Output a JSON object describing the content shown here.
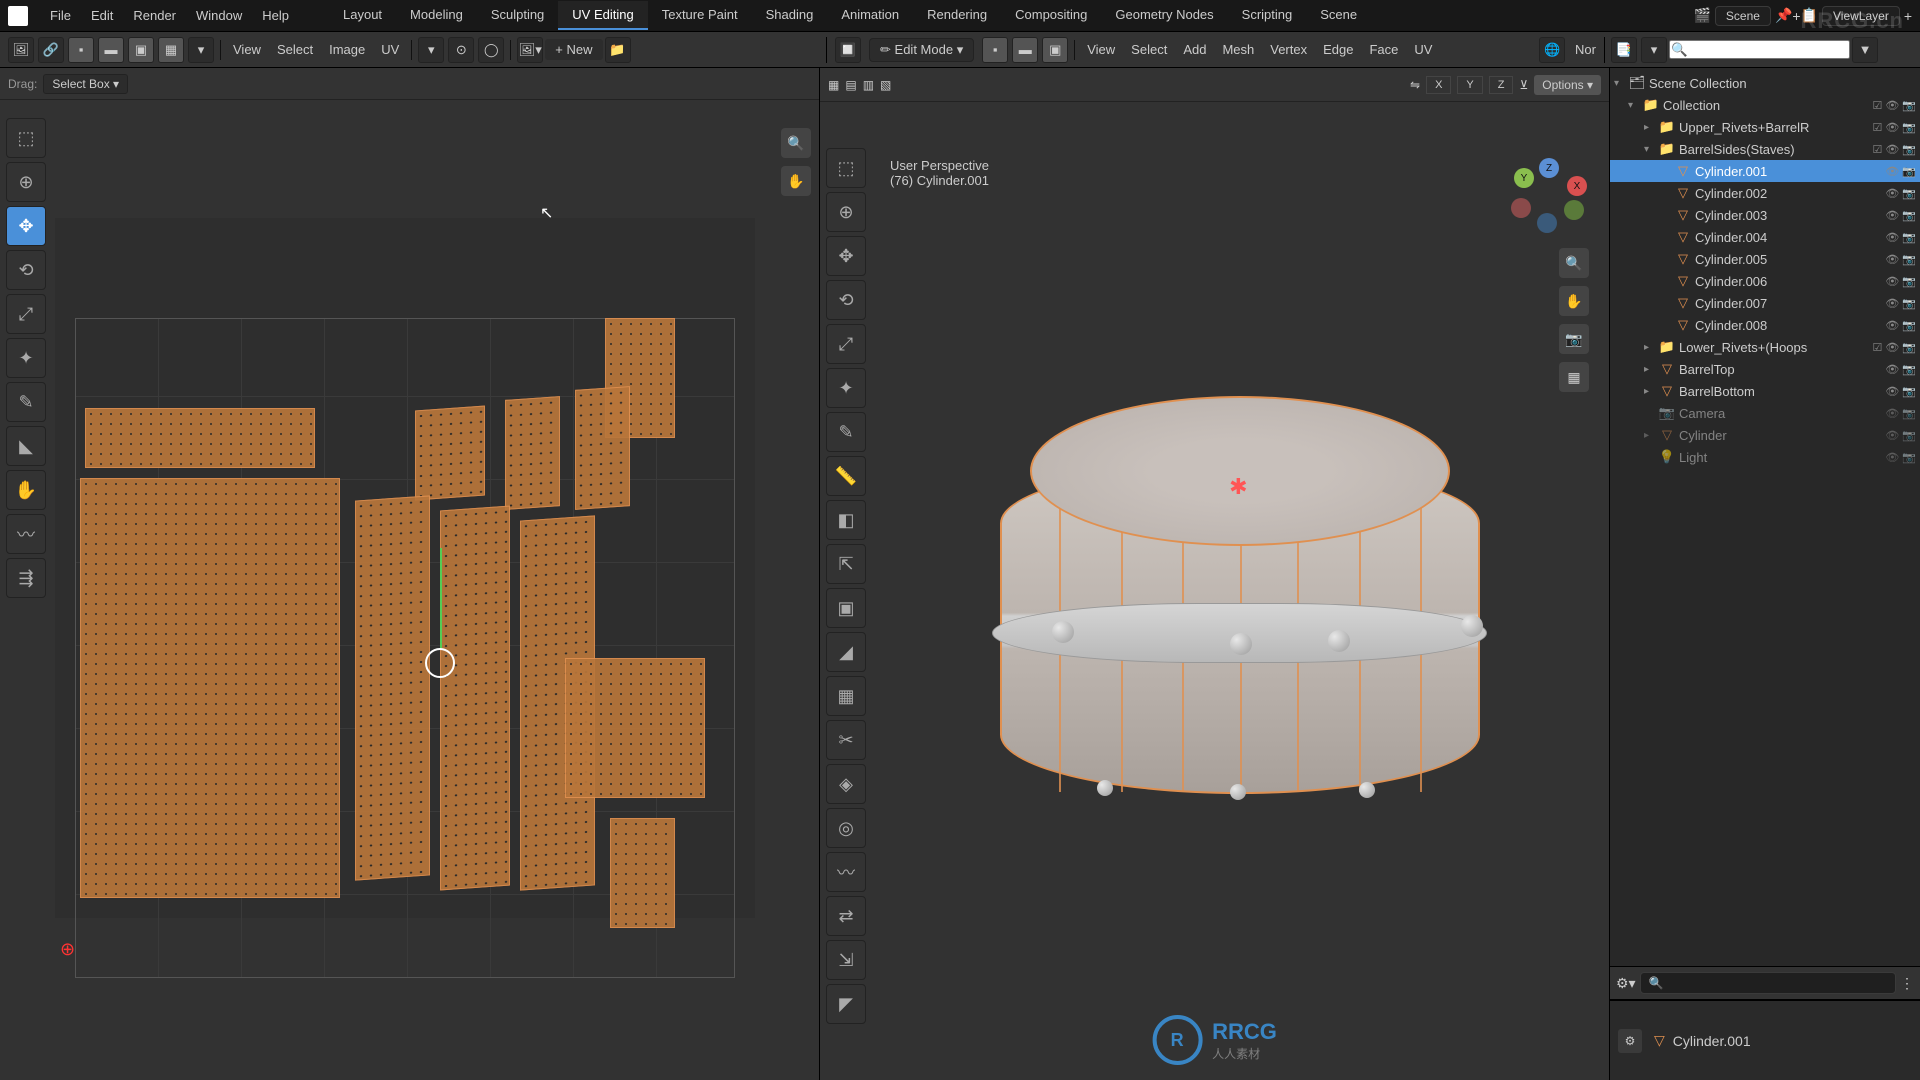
{
  "top_menu": {
    "file": "File",
    "edit": "Edit",
    "render": "Render",
    "window": "Window",
    "help": "Help"
  },
  "workspaces": {
    "layout": "Layout",
    "modeling": "Modeling",
    "sculpting": "Sculpting",
    "uv": "UV Editing",
    "texpaint": "Texture Paint",
    "shading": "Shading",
    "animation": "Animation",
    "rendering": "Rendering",
    "compositing": "Compositing",
    "geonodes": "Geometry Nodes",
    "scripting": "Scripting",
    "scene_label": "Scene"
  },
  "scene_name": "Scene",
  "viewlayer_name": "ViewLayer",
  "watermark": "RRCG.cn",
  "uv_header": {
    "view": "View",
    "select": "Select",
    "image": "Image",
    "uv": "UV",
    "new": "+ New",
    "open_icon": "📁"
  },
  "uv_drag": {
    "label": "Drag:",
    "mode": "Select Box"
  },
  "vp_header": {
    "mode": "Edit Mode",
    "view": "View",
    "select": "Select",
    "add": "Add",
    "mesh": "Mesh",
    "vertex": "Vertex",
    "edge": "Edge",
    "face": "Face",
    "uv": "UV",
    "normals": "Nor"
  },
  "vp_options": "Options",
  "vp_axes": {
    "x": "X",
    "y": "Y",
    "z": "Z"
  },
  "vp_overlay": {
    "persp": "User Perspective",
    "object": "(76) Cylinder.001"
  },
  "outliner": {
    "scene_collection": "Scene Collection",
    "collection": "Collection",
    "items": [
      {
        "name": "Upper_Rivets+BarrelR",
        "indent": 2,
        "expanded": false,
        "coll": true
      },
      {
        "name": "BarrelSides(Staves)",
        "indent": 2,
        "expanded": true,
        "coll": true
      },
      {
        "name": "Cylinder.001",
        "indent": 3,
        "expanded": false,
        "selected": true
      },
      {
        "name": "Cylinder.002",
        "indent": 3,
        "expanded": false
      },
      {
        "name": "Cylinder.003",
        "indent": 3,
        "expanded": false
      },
      {
        "name": "Cylinder.004",
        "indent": 3,
        "expanded": false
      },
      {
        "name": "Cylinder.005",
        "indent": 3,
        "expanded": false
      },
      {
        "name": "Cylinder.006",
        "indent": 3,
        "expanded": false
      },
      {
        "name": "Cylinder.007",
        "indent": 3,
        "expanded": false
      },
      {
        "name": "Cylinder.008",
        "indent": 3,
        "expanded": false
      },
      {
        "name": "Lower_Rivets+(Hoops",
        "indent": 2,
        "expanded": false,
        "coll": true
      },
      {
        "name": "BarrelTop",
        "indent": 2,
        "expanded": false,
        "obj": true
      },
      {
        "name": "BarrelBottom",
        "indent": 2,
        "expanded": false,
        "obj": true
      },
      {
        "name": "Camera",
        "indent": 2,
        "expanded": false,
        "disabled": true,
        "cam": true
      },
      {
        "name": "Cylinder",
        "indent": 2,
        "expanded": false,
        "disabled": true,
        "obj": true
      },
      {
        "name": "Light",
        "indent": 2,
        "expanded": false,
        "disabled": true,
        "light": true
      }
    ]
  },
  "props": {
    "active": "Cylinder.001"
  },
  "logo_text": "RRCG",
  "logo_sub": "人人素材"
}
